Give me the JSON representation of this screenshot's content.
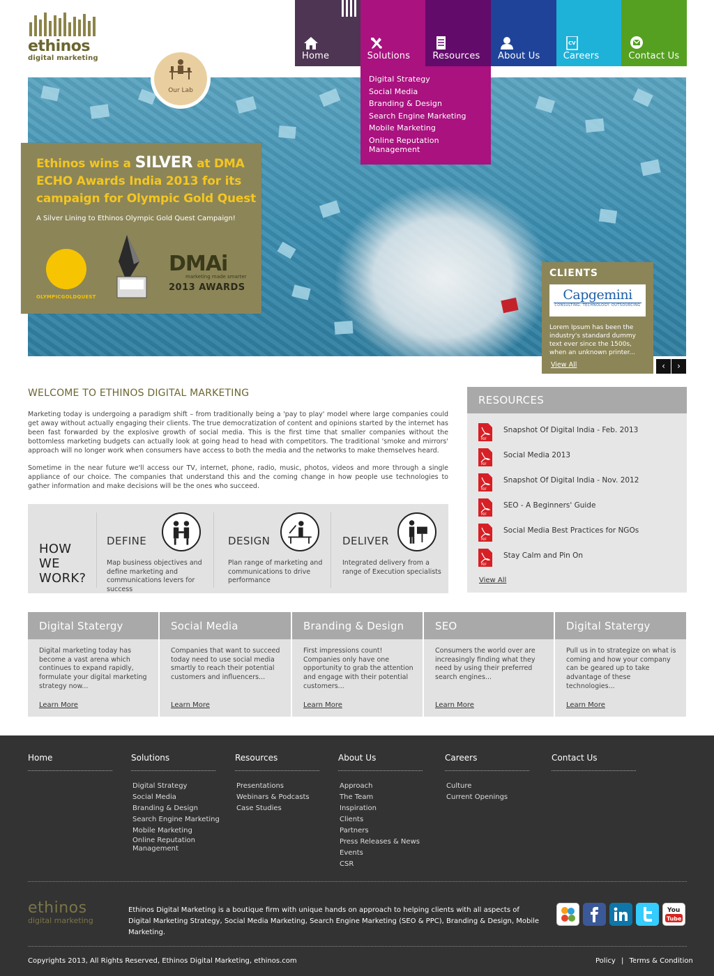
{
  "logo": {
    "name": "ethinos",
    "tagline": "digital marketing"
  },
  "nav": [
    {
      "label": "Home",
      "color": "#4e3553",
      "icon": "home-icon"
    },
    {
      "label": "Solutions",
      "color": "#a9127f",
      "icon": "tools-icon"
    },
    {
      "label": "Resources",
      "color": "#630b6b",
      "icon": "document-icon"
    },
    {
      "label": "About Us",
      "color": "#1e4399",
      "icon": "person-icon"
    },
    {
      "label": "Careers",
      "color": "#1eb2d9",
      "icon": "cv-icon"
    },
    {
      "label": "Contact Us",
      "color": "#55a020",
      "icon": "mail-icon"
    }
  ],
  "dropdown": [
    "Digital Strategy",
    "Social Media",
    "Branding & Design",
    "Search Engine Marketing",
    "Mobile Marketing",
    "Online Reputation Management"
  ],
  "lab": {
    "label": "Our Lab"
  },
  "award": {
    "title_pre": "Ethinos wins a ",
    "title_big": "SILVER",
    "title_post": " at DMA ECHO Awards India 2013 for its campaign for Olympic Gold Quest",
    "subtitle": "A Silver Lining to Ethinos Olympic Gold Quest Campaign!",
    "ogq_label": "OLYMPICGOLDQUEST",
    "dmai_logo": "DMAi",
    "dmai_tag": "marketing made smarter",
    "dmai_year": "2013 AWARDS"
  },
  "clients": {
    "title": "CLIENTS",
    "logo_name": "Capgemini",
    "logo_sub": "CONSULTING. TECHNOLOGY. OUTSOURCING",
    "text": "Lorem Ipsum has been the industry's standard dummy text ever since the 1500s, when an unknown printer...",
    "link": "View All"
  },
  "slider": {
    "prev": "‹",
    "next": "›"
  },
  "welcome": {
    "title": "WELCOME TO ETHINOS DIGITAL MARKETING",
    "p1": "Marketing today is undergoing a paradigm shift – from traditionally being a 'pay to play' model where large companies could get away without actually engaging their clients. The true democratization of content and opinions started by the internet has been fast forwarded by the explosive growth of social media. This is the first time that smaller companies without the bottomless marketing budgets can actually look at going head to head with competitors. The traditional 'smoke and mirrors' approach will no longer work when consumers have access to both the media and the networks to make themselves heard.",
    "p2": "Sometime in the near future we'll access our TV, internet, phone, radio, music, photos, videos and more through a single appliance of our choice. The companies that understand this and the coming change in how people use technologies to gather information and make decisions will be the ones who succeed."
  },
  "how": {
    "title_lines": [
      "HOW",
      "WE",
      "WORK?"
    ],
    "steps": [
      {
        "head": "DEFINE",
        "text": "Map business objectives and define marketing and communications levers for success",
        "icon": "handshake-icon"
      },
      {
        "head": "DESIGN",
        "text": "Plan range of marketing and communications to drive performance",
        "icon": "designer-desk-icon"
      },
      {
        "head": "DELIVER",
        "text": "Integrated delivery from a range of Execution specialists",
        "icon": "presenter-icon"
      }
    ]
  },
  "resources": {
    "title": "RESOURCES",
    "items": [
      "Snapshot Of Digital India - Feb. 2013",
      "Social Media 2013",
      "Snapshot Of Digital India - Nov. 2012",
      "SEO - A Beginners' Guide",
      "Social Media Best Practices for NGOs",
      "Stay Calm and Pin On"
    ],
    "pdf_label": "PDF",
    "link": "View All"
  },
  "cards": [
    {
      "title": "Digital Statergy",
      "text": "Digital marketing today has become a vast arena which continues to expand rapidly, formulate your digital marketing strategy now...",
      "link": "Learn More"
    },
    {
      "title": "Social Media",
      "text": "Companies that want to succeed today need to use social media smartly to reach their potential customers and influencers...",
      "link": "Learn More"
    },
    {
      "title": "Branding & Design",
      "text": "First impressions count! Companies only have one opportunity to grab the attention and engage with their potential customers...",
      "link": "Learn More"
    },
    {
      "title": "SEO",
      "text": "Consumers the world over are increasingly finding what they need by using their preferred search engines...",
      "link": "Learn More"
    },
    {
      "title": "Digital Statergy",
      "text": "Pull us in to strategize on what is coming and how your company can be geared up to take advantage of these technologies...",
      "link": "Learn More"
    }
  ],
  "footer": {
    "columns": [
      {
        "head": "Home",
        "items": []
      },
      {
        "head": "Solutions",
        "items": [
          "Digital Strategy",
          "Social Media",
          "Branding & Design",
          "Search Engine Marketing",
          "Mobile Marketing",
          "Online Reputation Management"
        ]
      },
      {
        "head": "Resources",
        "items": [
          "Presentations",
          "Webinars & Podcasts",
          "Case Studies"
        ]
      },
      {
        "head": "About Us",
        "items": [
          "Approach",
          "The Team",
          "Inspiration",
          "Clients",
          "Partners",
          "Press Releases & News",
          "Events",
          "CSR"
        ]
      },
      {
        "head": "Careers",
        "items": [
          "Culture",
          "Current Openings"
        ]
      },
      {
        "head": "Contact Us",
        "items": []
      }
    ],
    "logo_name": "ethinos",
    "logo_sub": "digital marketing",
    "about": "Ethinos Digital Marketing is a boutique firm with unique hands on approach to helping clients with all aspects of Digital Marketing Strategy, Social Media Marketing, Search Engine Marketing (SEO & PPC), Branding & Design, Mobile Marketing.",
    "social": [
      {
        "name": "stumbleupon-icon",
        "glyph": "su",
        "color": "#ef4a23"
      },
      {
        "name": "facebook-icon",
        "glyph": "f",
        "color": "#3b5998"
      },
      {
        "name": "linkedin-icon",
        "glyph": "in",
        "color": "#0e76a8"
      },
      {
        "name": "twitter-icon",
        "glyph": "t",
        "color": "#35ccff"
      },
      {
        "name": "youtube-icon",
        "glyph": "You",
        "color": "#d8231d"
      }
    ],
    "copyright": "Copyrights 2013, All Rights Reserved, Ethinos Digital Marketing, ethinos.com",
    "policy": "Policy",
    "sep": "|",
    "terms": "Terms & Condition"
  }
}
